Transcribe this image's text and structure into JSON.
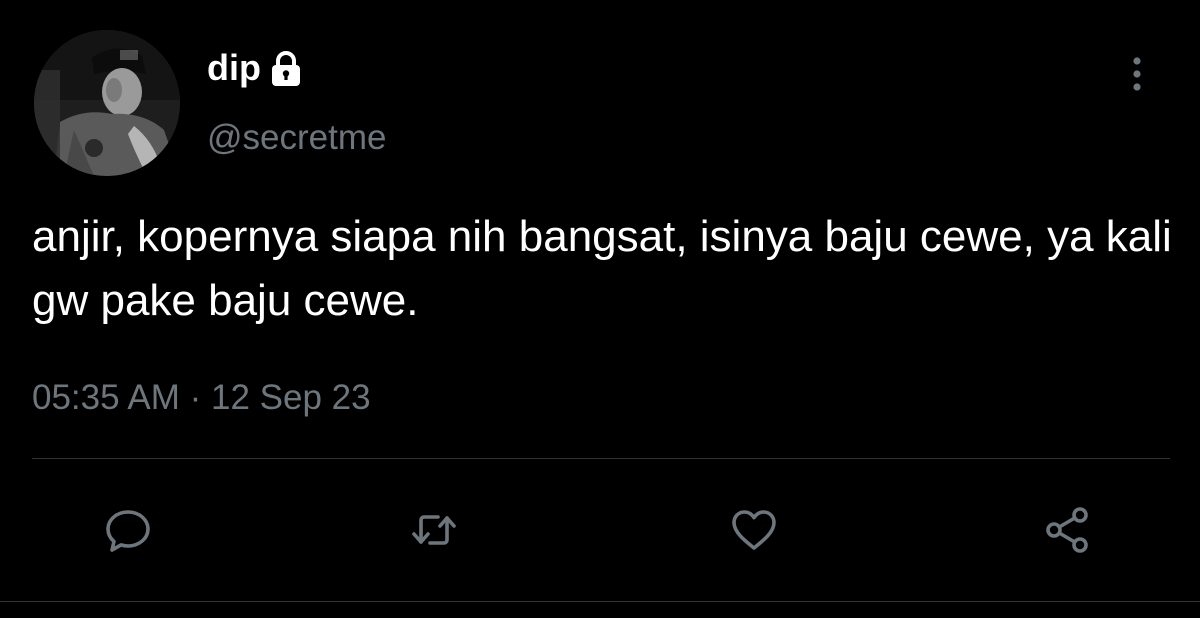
{
  "user": {
    "display_name": "dip",
    "handle": "@secretme",
    "protected_icon": "lock-icon",
    "avatar_icon": "profile-photo"
  },
  "tweet": {
    "text": "anjir, kopernya siapa nih bangsat, isinya baju cewe, ya kali gw pake baju cewe.",
    "time": "05:35 AM",
    "separator": "·",
    "date": "12 Sep 23"
  },
  "actions": [
    {
      "name": "reply",
      "icon": "comment-icon"
    },
    {
      "name": "retweet",
      "icon": "retweet-icon"
    },
    {
      "name": "like",
      "icon": "heart-icon"
    },
    {
      "name": "share",
      "icon": "share-icon"
    }
  ],
  "menu": {
    "icon": "more-vertical-icon"
  },
  "colors": {
    "background": "#000000",
    "text_primary": "#ffffff",
    "text_secondary": "#6e767d",
    "divider": "#2f3336"
  }
}
